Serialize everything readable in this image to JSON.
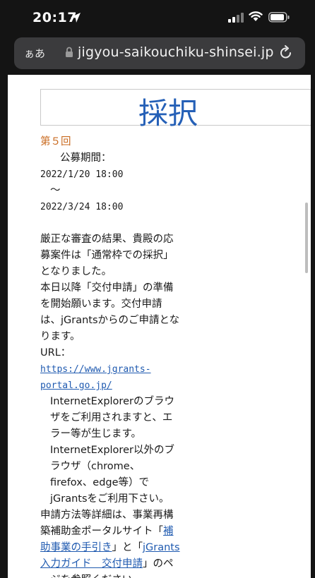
{
  "status": {
    "time": "20:17"
  },
  "browser": {
    "aa_label": "ぁあ",
    "url": "jigyou-saikouchiku-shinsei.jp"
  },
  "page": {
    "title": "採択",
    "round": "第５回",
    "period_label": "公募期間：",
    "period_start": "2022/1/20 18:00",
    "period_sep": "～",
    "period_end": "2022/3/24 18:00",
    "para1": "厳正な審査の結果、貴殿の応募案件は「通常枠での採択」となりました。",
    "para2": "本日以降「交付申請」の準備を開始願います。交付申請は、jGrantsからのご申請となります。",
    "url_prefix": "URL：",
    "url_link": "https://www.jgrants-portal.go.jp/",
    "ie_note": "InternetExplorerのブラウザをご利用されますと、エラー等が生じます。",
    "other_note": "InternetExplorer以外のブラウザ（chrome、firefox、edge等）でjGrantsをご利用下さい。",
    "guide_prefix": "申請方法等詳細は、事業再構築補助金ポータルサイト「",
    "guide_link1": "補助事業の手引き",
    "guide_mid": "」と「",
    "guide_link2": "jGrants入力ガイド　交付申請",
    "guide_suffix": "」のページを参照ください。"
  }
}
